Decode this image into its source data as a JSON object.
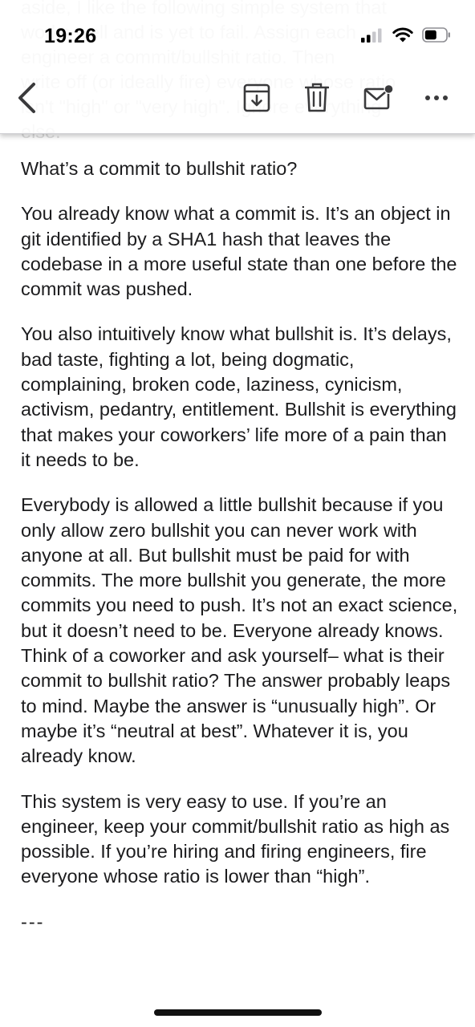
{
  "status_bar": {
    "time": "19:26",
    "icons": [
      "signal-icon",
      "wifi-icon",
      "battery-icon"
    ]
  },
  "ghost_text": {
    "lines": [
      "aside, I like the following simple system that",
      "works well and is yet to fail. Assign each",
      "engineer a commit/bullshit ratio. Then",
      "write off (or ideally fire) everyone whose ratio",
      "isn't \"high\" or \"very high\". Ignore everything",
      "else."
    ]
  },
  "toolbar": {
    "icons": [
      "back-chevron-icon",
      "archive-icon",
      "trash-icon",
      "mark-unread-icon",
      "more-icon"
    ]
  },
  "article": {
    "heading": "What’s a commit to bullshit ratio?",
    "paragraphs": [
      "You already know what a commit is. It’s an object in git identified by a SHA1 hash that leaves the codebase in a more useful state than one before the commit was pushed.",
      "You also intuitively know what bullshit is. It’s delays, bad taste, fighting a lot, being dogmatic, complaining, broken code, laziness, cynicism, activism, pedantry, entitlement. Bullshit is everything that makes your coworkers’ life more of a pain than it needs to be.",
      "Everybody is allowed a little bullshit because if you only allow zero bullshit you can never work with anyone at all. But bullshit must be paid for with commits. The more bullshit you generate, the more commits you need to push. It’s not an exact science, but it doesn’t need to be. Everyone already knows. Think of a coworker and ask yourself– what is their commit to bullshit ratio? The answer probably leaps to mind. Maybe the answer is “unusually high”. Or maybe it’s “neutral at best”. Whatever it is, you already know.",
      "This system is very easy to use. If you’re an engineer, keep your commit/bullshit ratio as high as possible. If you’re hiring and firing engineers, fire everyone whose ratio is lower than “high”."
    ],
    "separator": "---"
  },
  "colors": {
    "text": "#1c1c1e",
    "icon": "#3a3a3c",
    "background": "#ffffff"
  }
}
